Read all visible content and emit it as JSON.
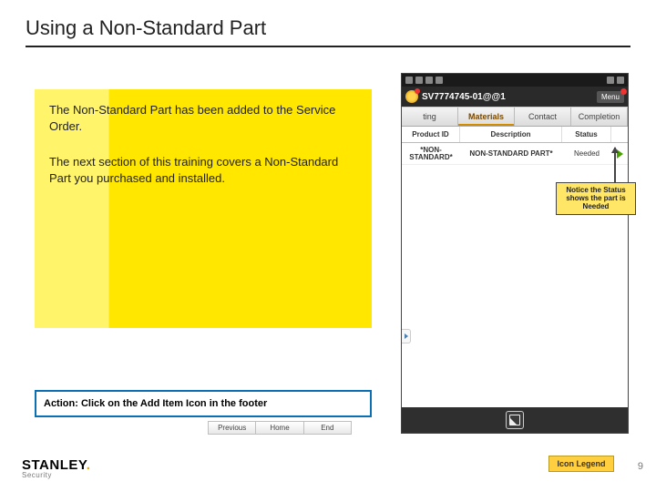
{
  "title": "Using a Non-Standard Part",
  "explain": {
    "p1": "The Non-Standard Part has been added to the Service Order.",
    "p2": "The next section of this training covers a Non-Standard Part you purchased and installed."
  },
  "action_text": "Action:  Click on the Add Item Icon in the footer",
  "nav": {
    "prev": "Previous",
    "home": "Home",
    "end": "End"
  },
  "logo": {
    "brand": "STANLEY",
    "sub": "Security"
  },
  "icon_legend": "Icon Legend",
  "page_num": "9",
  "phone": {
    "sv_title": "SV7774745-01@@1",
    "menu_label": "Menu",
    "tabs": [
      "ting",
      "Materials",
      "Contact",
      "Completion"
    ],
    "cols": [
      "Product ID",
      "Description",
      "Status",
      ""
    ],
    "row": {
      "product_id": "*NON-STANDARD*",
      "description": "NON-STANDARD PART*",
      "status": "Needed"
    }
  },
  "callout": "Notice the Status shows the part is Needed"
}
